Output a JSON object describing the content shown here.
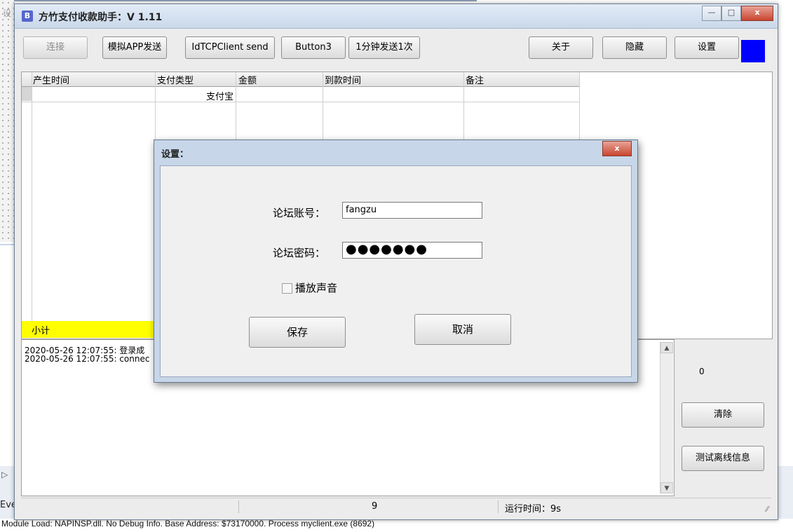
{
  "background": {
    "top_char": "设",
    "eve_text": "Eve",
    "module_load": "Module Load: NAPINSP.dll. No Debug Info. Base Address: $73170000. Process myclient.exe (8692)"
  },
  "window": {
    "title": "方竹支付收款助手：V 1.11",
    "controls": [
      "—",
      "□",
      "x"
    ]
  },
  "toolbar": {
    "connect": "连接",
    "simulate_app": "模拟APP发送",
    "idtcp": "IdTCPClient send",
    "button3": "Button3",
    "send_per_minute": "1分钟发送1次",
    "about": "关于",
    "hide": "隐藏",
    "settings": "设置",
    "indicator_color": "#0000ff"
  },
  "grid": {
    "columns": [
      "产生时间",
      "支付类型",
      "金额",
      "到款时间",
      "备注"
    ],
    "rows": [
      {
        "time": "",
        "pay_type": "支付宝",
        "amount": "",
        "arrive_time": "",
        "note": ""
      }
    ],
    "subtotal_label": "小计"
  },
  "log": {
    "lines": [
      "2020-05-26 12:07:55: 登录成",
      "2020-05-26 12:07:55: connec"
    ]
  },
  "side": {
    "count": "0",
    "clear": "清除",
    "test_offline": "测试离线信息"
  },
  "status": {
    "count": "9",
    "runtime": "运行时间：9s"
  },
  "dialog": {
    "title": "设置：",
    "close": "x",
    "account_label": "论坛账号：",
    "account_value": "fangzu",
    "password_label": "论坛密码：",
    "password_value": "●●●●●●●",
    "play_sound_label": "播放声音",
    "play_sound_checked": false,
    "save": "保存",
    "cancel": "取消"
  }
}
